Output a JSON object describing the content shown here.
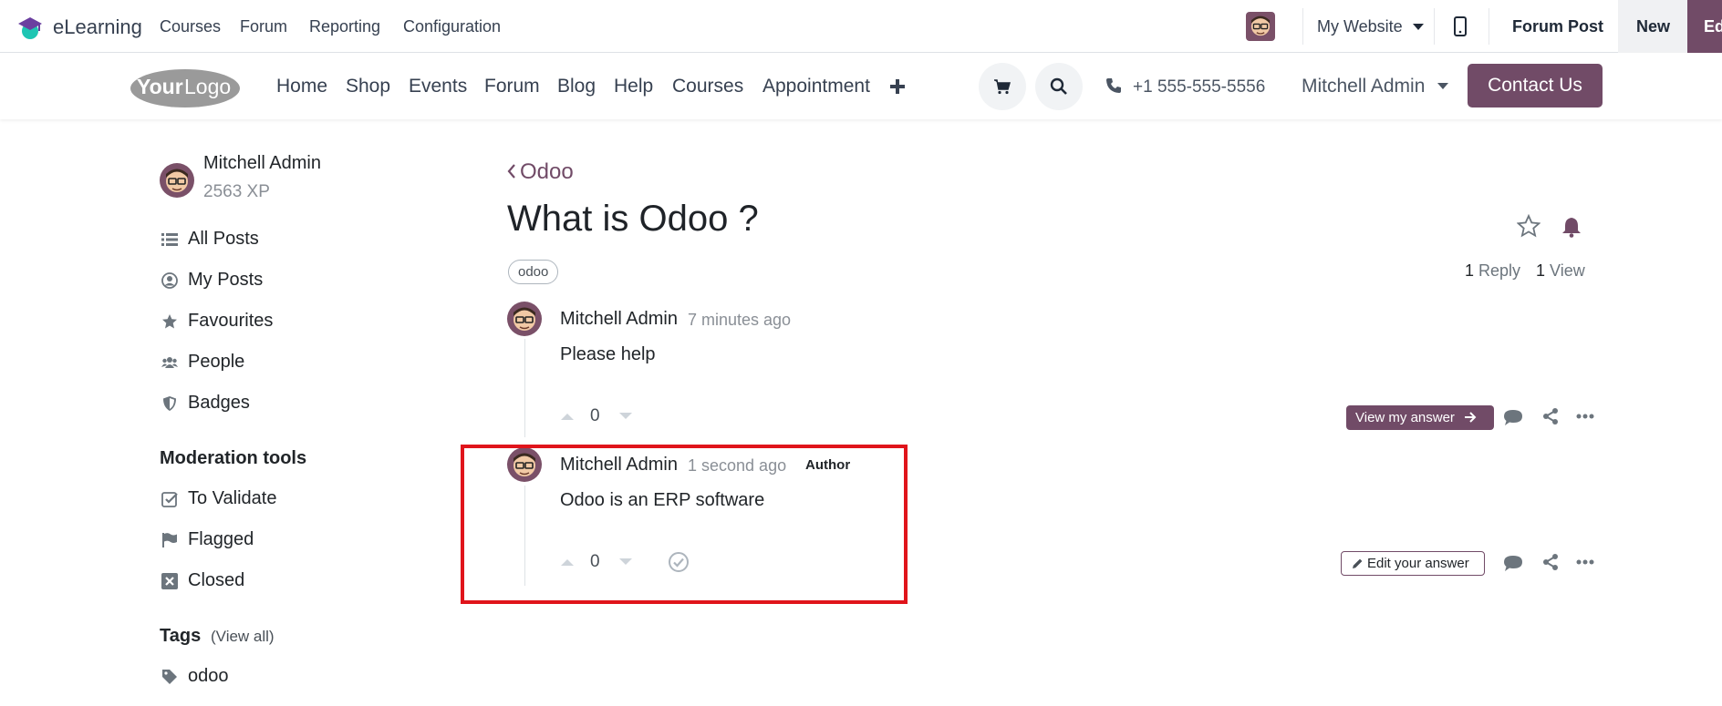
{
  "backend": {
    "app_name": "eLearning",
    "menu": [
      "Courses",
      "Forum",
      "Reporting",
      "Configuration"
    ],
    "website_selector": "My Website",
    "record_label": "Forum Post",
    "new_label": "New",
    "edit_label": "Edit"
  },
  "website": {
    "logo_text": "YourLogo",
    "nav": [
      "Home",
      "Shop",
      "Events",
      "Forum",
      "Blog",
      "Help",
      "Courses",
      "Appointment"
    ],
    "phone": "+1 555-555-5556",
    "user": "Mitchell Admin",
    "contact_label": "Contact Us"
  },
  "sidebar": {
    "user_name": "Mitchell Admin",
    "xp": "2563 XP",
    "items": [
      "All Posts",
      "My Posts",
      "Favourites",
      "People",
      "Badges"
    ],
    "moderation_title": "Moderation tools",
    "moderation_items": [
      "To Validate",
      "Flagged",
      "Closed"
    ],
    "tags_title": "Tags",
    "tags_view_all": "(View all)",
    "tags": [
      "odoo"
    ]
  },
  "question": {
    "breadcrumb": "Odoo",
    "title": "What is Odoo ?",
    "tag": "odoo",
    "reply_count": "1",
    "reply_label": "Reply",
    "view_count": "1",
    "view_label": "View",
    "author": "Mitchell Admin",
    "time": "7 minutes ago",
    "content": "Please help",
    "votes": "0",
    "view_answer_label": "View my answer"
  },
  "answer": {
    "author": "Mitchell Admin",
    "time": "1 second ago",
    "badge": "Author",
    "content": "Odoo is an ERP software",
    "votes": "0",
    "edit_label": "Edit your answer"
  },
  "colors": {
    "brand": "#714b67",
    "highlight": "#e0141b"
  }
}
